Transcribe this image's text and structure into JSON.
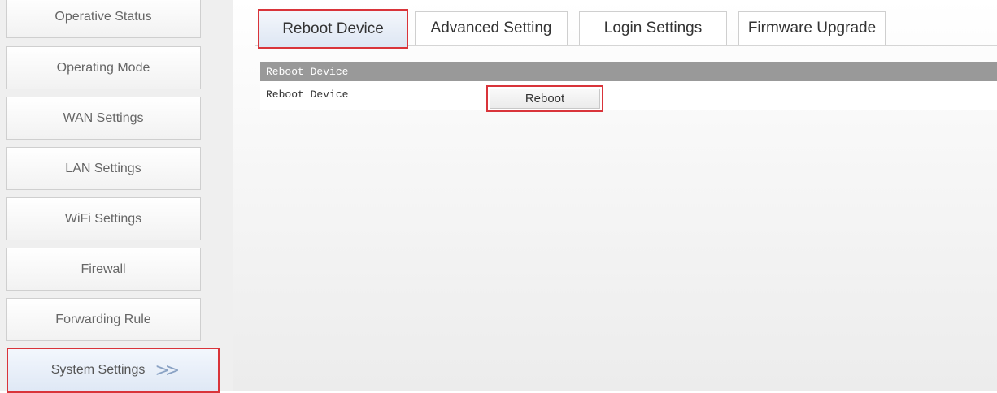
{
  "sidebar": {
    "items": [
      {
        "label": "Operative Status"
      },
      {
        "label": "Operating Mode"
      },
      {
        "label": "WAN Settings"
      },
      {
        "label": "LAN Settings"
      },
      {
        "label": "WiFi Settings"
      },
      {
        "label": "Firewall"
      },
      {
        "label": "Forwarding Rule"
      },
      {
        "label": "System Settings",
        "active": true,
        "icon": "double-chevron-right-icon"
      }
    ],
    "active_arrow": ">>"
  },
  "tabs": [
    {
      "label": "Reboot Device",
      "active": true
    },
    {
      "label": "Advanced Setting"
    },
    {
      "label": "Login Settings"
    },
    {
      "label": "Firmware Upgrade"
    }
  ],
  "panel": {
    "header": "Reboot Device",
    "row_label": "Reboot Device",
    "button_label": "Reboot"
  },
  "colors": {
    "highlight_border": "#d9343a",
    "panel_header_bg": "#999999",
    "active_bg": "#dde6f3"
  }
}
